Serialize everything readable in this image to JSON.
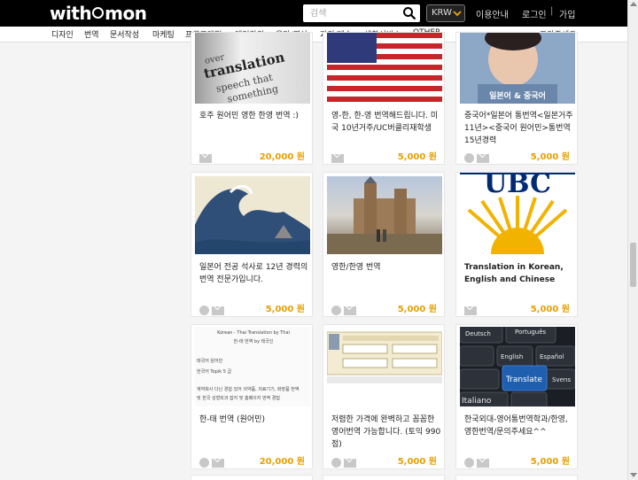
{
  "header": {
    "logo": "withmon",
    "search_placeholder": "검색",
    "currency": "KRW",
    "links": {
      "guide": "이용안내",
      "login": "로그인",
      "separator": "|",
      "join": "가입"
    }
  },
  "categories": [
    "디자인",
    "번역",
    "문서작성",
    "마케팅",
    "프로그래밍",
    "게임강의",
    "음악/영상",
    "과외/레슨",
    "생활서비스",
    "OTHER"
  ],
  "help_link": "도와주세요",
  "image_text": {
    "portrait_caption": "일본어 & 중국어",
    "ubc": "UBC",
    "thai_line1": "Korean - Thai Translation by Thai",
    "thai_line2": "한-태 번역 by 태국인",
    "thai_line3": "태국어 원어민",
    "thai_line4": "한국어 Topik 5 급",
    "thai_line5": "계약회사 다닌 경험 있어 의약품, 의료기기, 화장품 번역",
    "thai_line6": "및 한국 성형외과 잡지 및 홈페이지 번역 경험",
    "key_portugues": "Português",
    "key_english": "English",
    "key_espanol": "Español",
    "key_translate": "Translate",
    "key_italiano": "Italiano",
    "key_svenska": "Svens",
    "key_deutsch": "Deutsch"
  },
  "cards": [
    {
      "title": "호주 원어민 영한 한영 번역 :)",
      "price": "20,000 원",
      "icons": [
        "mail-icon"
      ]
    },
    {
      "title": "영-한, 한-영 번역해드립니다. 미국 10년거주/UC버클리재학생",
      "price": "5,000 원",
      "icons": [
        "mail-icon"
      ]
    },
    {
      "title": "중국어*일본어 통번역<일본거주 11년><중국어 원어민>통번역15년경력",
      "price": "5,000 원",
      "icons": [
        "phone-icon",
        "mail-icon"
      ]
    },
    {
      "title": "일본어 전공 석사로 12년 경력의 번역 전문가입니다.",
      "price": "5,000 원",
      "icons": [
        "phone-icon",
        "mail-icon"
      ]
    },
    {
      "title": "영한/한영 번역",
      "price": "5,000 원",
      "icons": [
        "phone-icon",
        "mail-icon"
      ]
    },
    {
      "title": "Translation in Korean, English and Chinese",
      "price": "5,000 원",
      "icons": [
        "mail-icon"
      ]
    },
    {
      "title": "한-태 번역 (원어민)",
      "price": "20,000 원",
      "icons": [
        "phone-icon",
        "mail-icon"
      ]
    },
    {
      "title": "저렴한 가격에 완벽하고 꼼꼼한 영어번역 가능합니다. (토익 990점)",
      "price": "5,000 원",
      "icons": [
        "phone-icon",
        "mail-icon"
      ]
    },
    {
      "title": "한국외대-영어통번역학과/한영,영한번역/문의주세요^^",
      "price": "5,000 원",
      "icons": [
        "phone-icon",
        "mail-icon"
      ]
    }
  ]
}
